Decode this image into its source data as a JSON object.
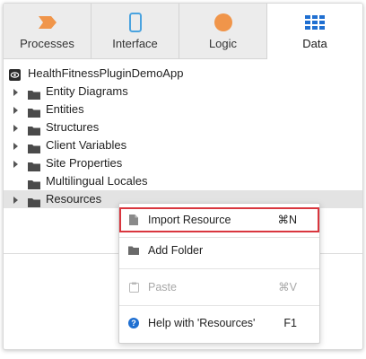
{
  "tabs": [
    {
      "label": "Processes",
      "icon": "processes-icon",
      "color": "#f0954a"
    },
    {
      "label": "Interface",
      "icon": "interface-icon",
      "color": "#4aa3df"
    },
    {
      "label": "Logic",
      "icon": "logic-icon",
      "color": "#f0954a"
    },
    {
      "label": "Data",
      "icon": "data-icon",
      "color": "#1f6fd1",
      "active": true
    }
  ],
  "tree": {
    "root": "HealthFitnessPluginDemoApp",
    "items": [
      {
        "label": "Entity Diagrams",
        "expandable": true
      },
      {
        "label": "Entities",
        "expandable": true
      },
      {
        "label": "Structures",
        "expandable": true
      },
      {
        "label": "Client Variables",
        "expandable": true
      },
      {
        "label": "Site Properties",
        "expandable": true
      },
      {
        "label": "Multilingual Locales",
        "expandable": false
      },
      {
        "label": "Resources",
        "expandable": true,
        "selected": true
      }
    ]
  },
  "context_menu": {
    "items": [
      {
        "label": "Import Resource",
        "shortcut": "⌘N",
        "icon": "file-icon",
        "highlighted": true
      },
      {
        "label": "Add Folder",
        "shortcut": "",
        "icon": "folder-icon"
      },
      {
        "label": "Paste",
        "shortcut": "⌘V",
        "icon": "clipboard-icon",
        "disabled": true
      },
      {
        "label": "Help with 'Resources'",
        "shortcut": "F1",
        "icon": "help-icon"
      }
    ]
  },
  "colors": {
    "highlight_border": "#d9363e",
    "help_icon": "#1f6fd1",
    "folder": "#4a4a4a"
  }
}
